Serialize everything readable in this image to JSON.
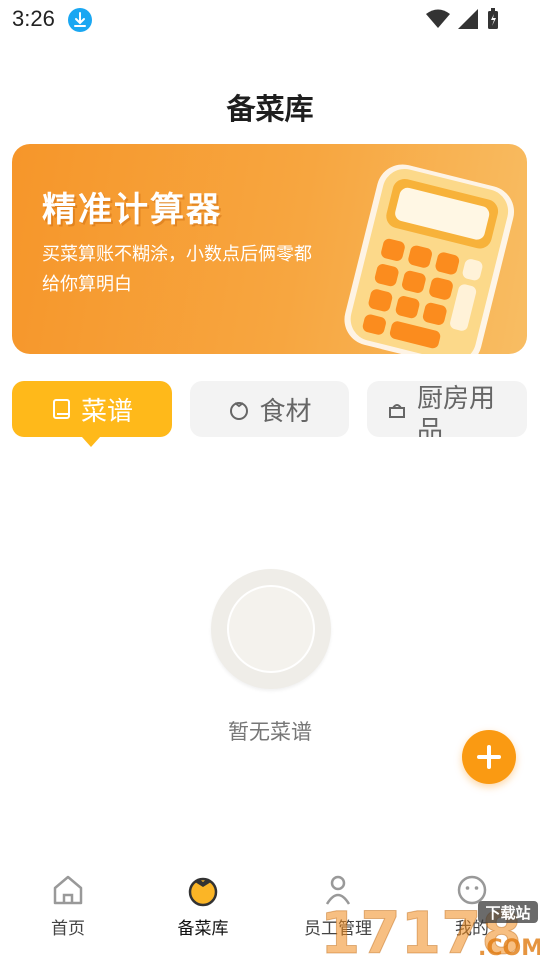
{
  "status_bar": {
    "time": "3:26"
  },
  "header": {
    "title": "备菜库"
  },
  "banner": {
    "title": "精准计算器",
    "description": "买菜算账不糊涂，小数点后俩零都给你算明白"
  },
  "tabs": [
    {
      "label": "菜谱",
      "active": true
    },
    {
      "label": "食材",
      "active": false
    },
    {
      "label": "厨房用品",
      "active": false
    }
  ],
  "empty_state": {
    "text": "暂无菜谱"
  },
  "bottom_nav": [
    {
      "label": "首页",
      "icon": "home-icon"
    },
    {
      "label": "备菜库",
      "icon": "tomato-icon",
      "active": true
    },
    {
      "label": "员工管理",
      "icon": "person-icon"
    },
    {
      "label": "我的",
      "icon": "smile-icon"
    }
  ],
  "watermark": {
    "text": "17178",
    "sub": "下载站",
    "com": ".COM"
  },
  "colors": {
    "accent": "#ffb91a",
    "fab": "#fa9a12",
    "banner": "#f6962a"
  }
}
